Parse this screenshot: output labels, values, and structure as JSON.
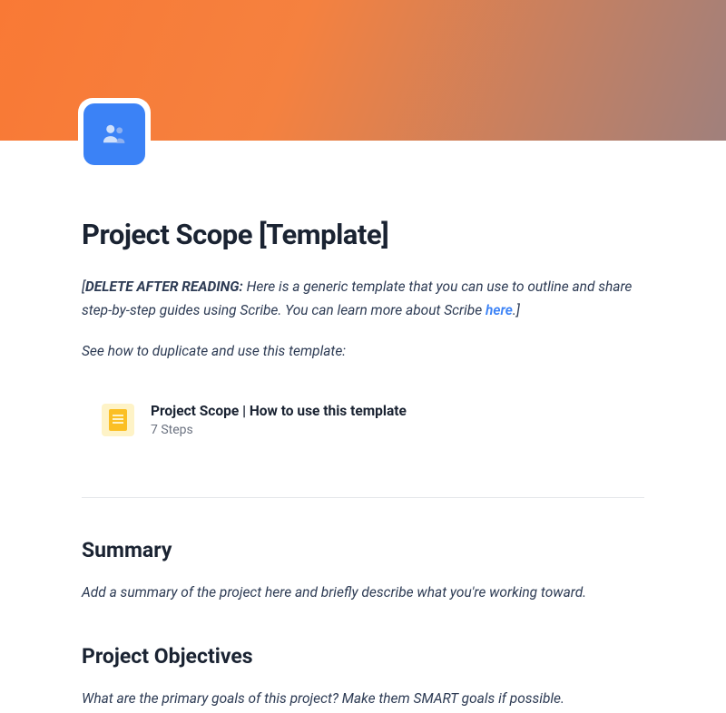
{
  "header": {
    "icon_name": "people-icon"
  },
  "title": "Project Scope [Template]",
  "note": {
    "prefix": "[",
    "bold_label": "DELETE AFTER READING:",
    "body": " Here is a generic template that you can use to outline and share step-by-step guides using Scribe. You can learn more about Scribe ",
    "link_text": "here",
    "suffix": ".]"
  },
  "instruction": "See how to duplicate and use this template:",
  "template_card": {
    "title": "Project Scope | How to use this template",
    "steps": "7 Steps"
  },
  "sections": [
    {
      "heading": "Summary",
      "text": "Add a summary of the project here and briefly describe what you're working toward."
    },
    {
      "heading": "Project Objectives",
      "text": "What are the primary goals of this project? Make them SMART goals if possible."
    }
  ]
}
